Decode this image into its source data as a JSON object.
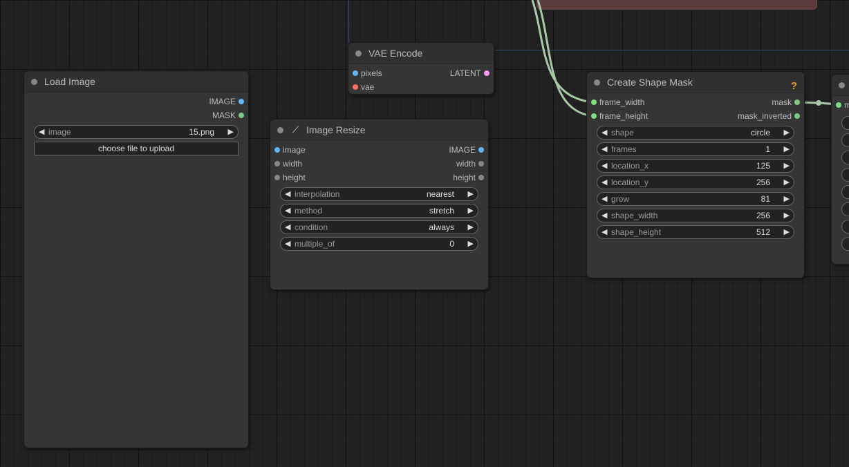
{
  "nodes": {
    "load_image": {
      "title": "Load Image",
      "outputs": [
        "IMAGE",
        "MASK"
      ],
      "image_widget": {
        "name": "image",
        "value": "15.png"
      },
      "upload_label": "choose file to upload"
    },
    "vae_encode": {
      "title": "VAE Encode",
      "inputs": [
        "pixels",
        "vae"
      ],
      "outputs": [
        "LATENT"
      ]
    },
    "image_resize": {
      "title": "Image Resize",
      "inputs": [
        "image",
        "width",
        "height"
      ],
      "outputs": [
        "IMAGE",
        "width",
        "height"
      ],
      "widgets": [
        {
          "name": "interpolation",
          "value": "nearest"
        },
        {
          "name": "method",
          "value": "stretch"
        },
        {
          "name": "condition",
          "value": "always"
        },
        {
          "name": "multiple_of",
          "value": "0"
        }
      ]
    },
    "create_shape_mask": {
      "title": "Create Shape Mask",
      "help": "?",
      "inputs": [
        "frame_width",
        "frame_height"
      ],
      "outputs": [
        "mask",
        "mask_inverted"
      ],
      "widgets": [
        {
          "name": "shape",
          "value": "circle"
        },
        {
          "name": "frames",
          "value": "1"
        },
        {
          "name": "location_x",
          "value": "125"
        },
        {
          "name": "location_y",
          "value": "256"
        },
        {
          "name": "grow",
          "value": "81"
        },
        {
          "name": "shape_width",
          "value": "256"
        },
        {
          "name": "shape_height",
          "value": "512"
        }
      ]
    },
    "partial_node": {
      "input_label": "m"
    }
  },
  "colors": {
    "image": "#64b5f6",
    "mask": "#81c784",
    "latent": "#ff9cf9",
    "vae": "#ff6e6e",
    "int": "#888888",
    "wire_green": "#a8c8a8"
  }
}
